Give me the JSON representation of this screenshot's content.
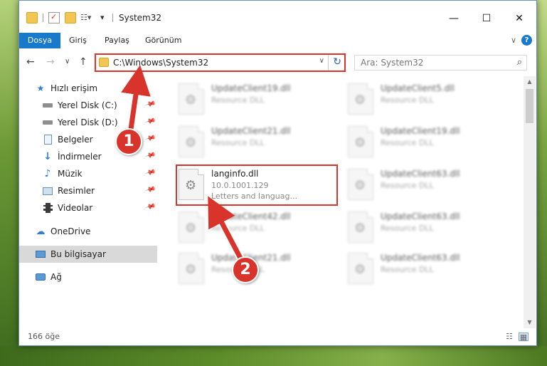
{
  "window": {
    "title": "System32",
    "minimize": "—",
    "maximize": "☐",
    "close": "✕"
  },
  "ribbon": {
    "tabs": [
      "Dosya",
      "Giriş",
      "Paylaş",
      "Görünüm"
    ],
    "collapse": "∨",
    "help": "?"
  },
  "nav": {
    "back": "←",
    "forward": "→",
    "recent": "∨",
    "up": "↑",
    "address": "C:\\Windows\\System32",
    "address_dropdown": "∨",
    "refresh": "↻",
    "search_placeholder": "Ara: System32"
  },
  "sidebar": {
    "items": [
      {
        "label": "Hızlı erişim",
        "icon": "star-icon",
        "pinned": false
      },
      {
        "label": "Yerel Disk (C:)",
        "icon": "drive-icon",
        "pinned": true
      },
      {
        "label": "Yerel Disk (D:)",
        "icon": "drive-icon",
        "pinned": true
      },
      {
        "label": "Belgeler",
        "icon": "documents-icon",
        "pinned": true
      },
      {
        "label": "İndirmeler",
        "icon": "download-icon",
        "pinned": true
      },
      {
        "label": "Müzik",
        "icon": "music-icon",
        "pinned": true
      },
      {
        "label": "Resimler",
        "icon": "pictures-icon",
        "pinned": true
      },
      {
        "label": "Videolar",
        "icon": "video-icon",
        "pinned": true
      },
      {
        "label": "OneDrive",
        "icon": "cloud-icon",
        "pinned": false
      },
      {
        "label": "Bu bilgisayar",
        "icon": "computer-icon",
        "pinned": false,
        "selected": true
      },
      {
        "label": "Ağ",
        "icon": "network-icon",
        "pinned": false
      }
    ]
  },
  "files": [
    {
      "name": "UpdateClient19.dll",
      "sub": "Resource DLL",
      "blurred": true
    },
    {
      "name": "UpdateClient5.dll",
      "sub": "Resource DLL",
      "blurred": true
    },
    {
      "name": "UpdateClient21.dll",
      "sub": "Resource DLL",
      "blurred": true
    },
    {
      "name": "UpdateClient19.dll",
      "sub": "Resource DLL",
      "blurred": true
    },
    {
      "name": "langinfo.dll",
      "sub": "10.0.1001.129",
      "sub2": "Letters and languag...",
      "blurred": false
    },
    {
      "name": "UpdateClient63.dll",
      "sub": "Resource DLL",
      "blurred": true
    },
    {
      "name": "UpdateClient42.dll",
      "sub": "Resource DLL",
      "blurred": true
    },
    {
      "name": "UpdateClient63.dll",
      "sub": "Resource DLL",
      "blurred": true
    },
    {
      "name": "UpdateClient21.dll",
      "sub": "Resource DLL",
      "blurred": true
    },
    {
      "name": "UpdateClient63.dll",
      "sub": "Resource DLL",
      "blurred": true
    }
  ],
  "status": {
    "count": "166 öğe"
  },
  "annotations": {
    "badge1": "1",
    "badge2": "2",
    "color": "#d9342b"
  }
}
